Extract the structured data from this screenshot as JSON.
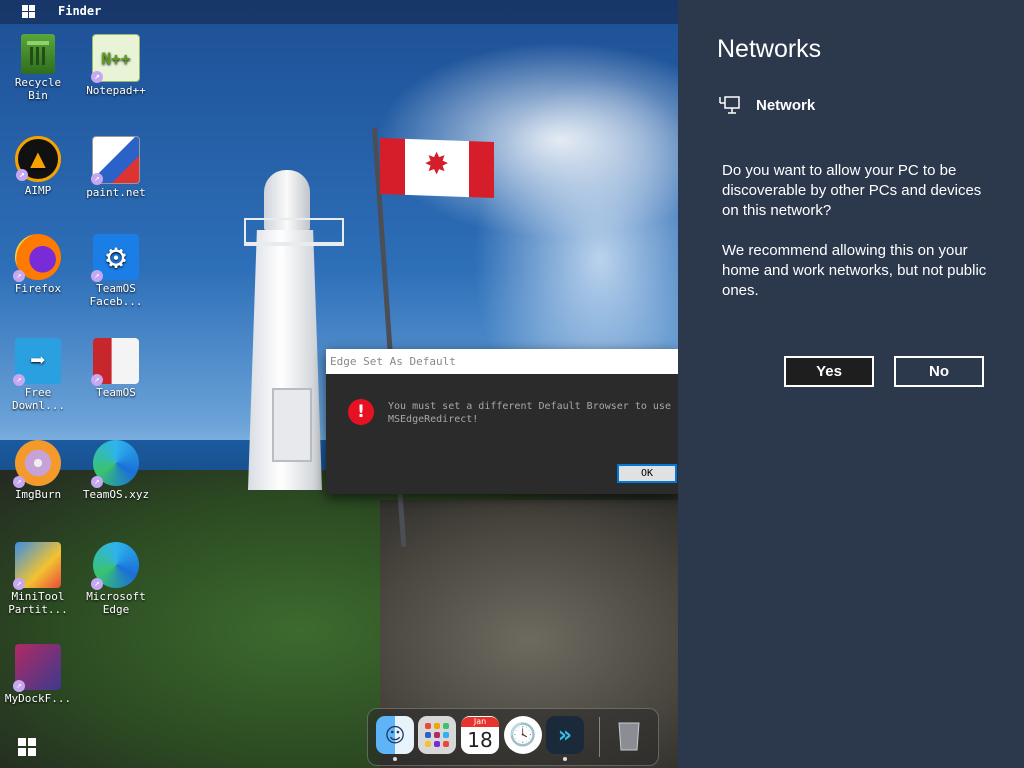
{
  "topbar": {
    "app_name": "Finder"
  },
  "desktop_icons": [
    {
      "label": "Recycle\nBin",
      "icon": "recycle-bin-icon"
    },
    {
      "label": "Notepad++",
      "icon": "notepadpp-icon"
    },
    {
      "label": "AIMP",
      "icon": "aimp-icon"
    },
    {
      "label": "paint.net",
      "icon": "paintnet-icon"
    },
    {
      "label": "Firefox",
      "icon": "firefox-icon"
    },
    {
      "label": "TeamOS Faceb...",
      "icon": "gear-icon"
    },
    {
      "label": "Free Downl...",
      "icon": "download-arrow-icon"
    },
    {
      "label": "TeamOS",
      "icon": "teamos-icon"
    },
    {
      "label": "ImgBurn",
      "icon": "imgburn-icon"
    },
    {
      "label": "TeamOS.xyz",
      "icon": "edge-icon"
    },
    {
      "label": "MiniTool Partit...",
      "icon": "minitool-icon"
    },
    {
      "label": "Microsoft Edge",
      "icon": "edge-icon"
    },
    {
      "label": "MyDockF...",
      "icon": "mydock-icon"
    }
  ],
  "dialog": {
    "title": "Edge Set As Default",
    "message": "You must set a different Default Browser to use MSEdgeRedirect!",
    "ok_label": "OK",
    "icon": "error-icon"
  },
  "dock": {
    "calendar_month": "Jan",
    "calendar_day": "18",
    "apps": [
      "finder-icon",
      "launchpad-icon",
      "calendar-icon",
      "clock-icon",
      "mydock-icon",
      "trash-icon"
    ]
  },
  "networks": {
    "title": "Networks",
    "network_name": "Network",
    "question": "Do you want to allow your PC to be discoverable by other PCs and devices on this network?",
    "recommendation": "We recommend allowing this on your home and work networks, but not public ones.",
    "yes_label": "Yes",
    "no_label": "No"
  }
}
